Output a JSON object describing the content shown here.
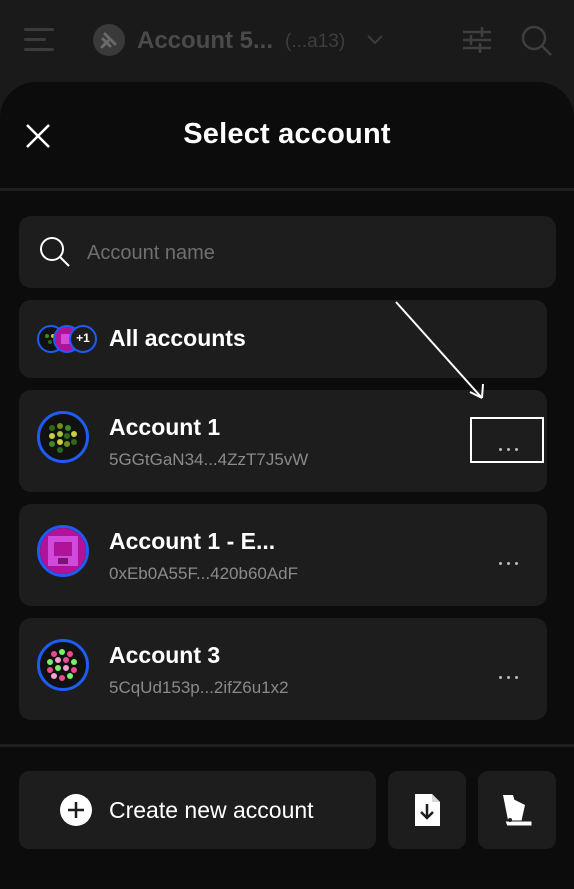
{
  "header": {
    "account_name": "Account 5...",
    "account_address": "(...a13)",
    "icons": [
      "menu-icon",
      "plug-icon",
      "chevron-down-icon",
      "sliders-icon",
      "search-icon"
    ]
  },
  "sheet": {
    "title": "Select account",
    "search": {
      "placeholder": "Account name"
    },
    "all_accounts_label": "All accounts",
    "all_accounts_badge": "+1",
    "accounts": [
      {
        "name": "Account 1",
        "address": "5GGtGaN34...4ZzT7J5vW"
      },
      {
        "name": "Account 1 - E...",
        "address": "0xEb0A55F...420b60AdF"
      },
      {
        "name": "Account 3",
        "address": "5CqUd153p...2ifZ6u1x2"
      }
    ],
    "footer": {
      "create_label": "Create new account"
    }
  },
  "colors": {
    "accent": "#1d5cf5",
    "background": "#0c0c0c",
    "card": "#1d1d1d",
    "muted_text": "#8a8a8a"
  }
}
